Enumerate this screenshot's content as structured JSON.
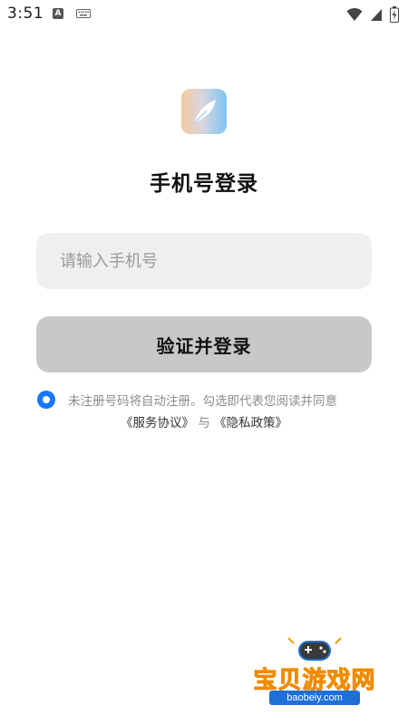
{
  "status_bar": {
    "time": "3:51",
    "app_icon_letter": "A"
  },
  "login": {
    "title": "手机号登录",
    "phone_placeholder": "请输入手机号",
    "phone_value": "",
    "submit_label": "验证并登录",
    "agree_checked": true,
    "agree_text": "未注册号码将自动注册。勾选即代表您阅读并同意",
    "service_link": "《服务协议》",
    "connector": "与",
    "privacy_link": "《隐私政策》"
  },
  "watermark": {
    "name": "宝贝游戏网",
    "url": "baobeiy.com"
  },
  "colors": {
    "accent": "#1677ff",
    "button_disabled": "#c8c8c8",
    "input_bg": "#efefef"
  }
}
